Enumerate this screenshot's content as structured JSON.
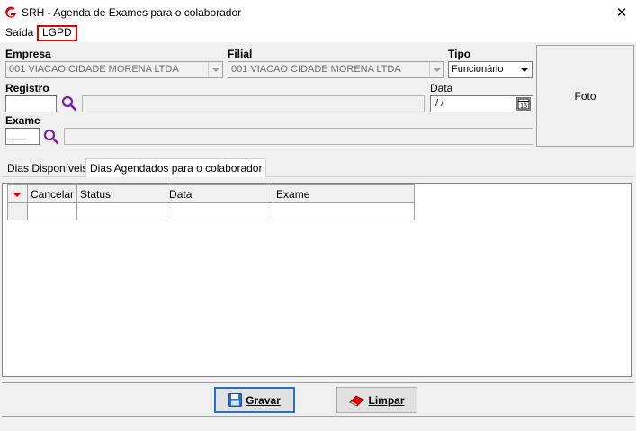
{
  "window": {
    "title": "SRH - Agenda de Exames para o colaborador",
    "close_glyph": "✕"
  },
  "menu": {
    "items": [
      {
        "label": "Saída"
      },
      {
        "label": "LGPD"
      }
    ]
  },
  "form": {
    "empresa_label": "Empresa",
    "empresa_value": "001 VIACAO CIDADE MORENA LTDA",
    "filial_label": "Filial",
    "filial_value": "001 VIACAO CIDADE MORENA LTDA",
    "tipo_label": "Tipo",
    "tipo_value": "Funcionário",
    "registro_label": "Registro",
    "registro_value": "",
    "data_label": "Data",
    "data_value": " /  /",
    "exame_label": "Exame",
    "exame_value": "___"
  },
  "photo": {
    "label": "Foto"
  },
  "tabs": [
    {
      "label": "Dias Disponíveis",
      "active": false
    },
    {
      "label": "Dias Agendados para o colaborador",
      "active": true
    }
  ],
  "grid": {
    "columns": [
      "Cancelar",
      "Status",
      "Data",
      "Exame"
    ],
    "rows": [
      [
        "",
        "",
        "",
        ""
      ]
    ]
  },
  "buttons": {
    "gravar": "Gravar",
    "limpar": "Limpar"
  },
  "colors": {
    "accent_red": "#e00000",
    "search_icon": "#7a1fa2"
  }
}
